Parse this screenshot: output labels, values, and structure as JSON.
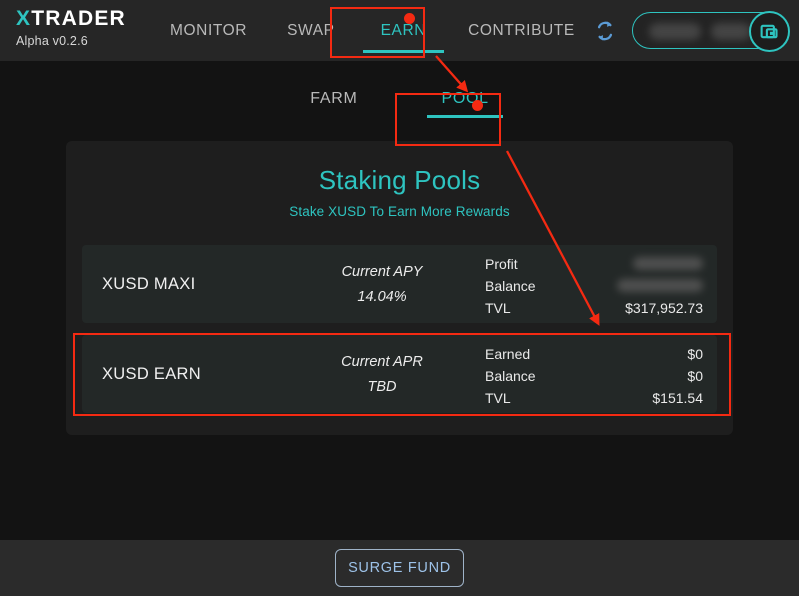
{
  "header": {
    "logo_x": "X",
    "logo_rest": "TRADER",
    "version": "Alpha v0.2.6",
    "nav": [
      {
        "label": "MONITOR",
        "active": false
      },
      {
        "label": "SWAP",
        "active": false
      },
      {
        "label": "EARN",
        "active": true
      },
      {
        "label": "CONTRIBUTE",
        "active": false
      }
    ],
    "refresh_icon": "refresh-icon",
    "wallet": {
      "address": "",
      "icon": "wallet-icon",
      "redacted": true
    }
  },
  "subtabs": [
    {
      "label": "FARM",
      "active": false
    },
    {
      "label": "POOL",
      "active": true
    }
  ],
  "panel": {
    "title": "Staking Pools",
    "subtitle": "Stake XUSD To Earn More Rewards",
    "pools": [
      {
        "name": "XUSD MAXI",
        "rate_label": "Current APY",
        "rate_value": "14.04%",
        "stats": [
          {
            "label": "Profit",
            "value": "",
            "redacted": true
          },
          {
            "label": "Balance",
            "value": "",
            "redacted": true
          },
          {
            "label": "TVL",
            "value": "$317,952.73",
            "redacted": false
          }
        ]
      },
      {
        "name": "XUSD EARN",
        "rate_label": "Current APR",
        "rate_value": "TBD",
        "stats": [
          {
            "label": "Earned",
            "value": "$0",
            "redacted": false
          },
          {
            "label": "Balance",
            "value": "$0",
            "redacted": false
          },
          {
            "label": "TVL",
            "value": "$151.54",
            "redacted": false
          }
        ]
      }
    ]
  },
  "footer": {
    "surge_fund_label": "SURGE FUND"
  },
  "colors": {
    "accent_teal": "#2ec4c0",
    "annotation_red": "#f42a12",
    "header_bg": "#262626",
    "body_bg": "#131313",
    "panel_bg": "#1e1e1e",
    "card_bg": "#232827",
    "footer_bg": "#2b2b2b",
    "surge_text": "#9dc2e8"
  }
}
